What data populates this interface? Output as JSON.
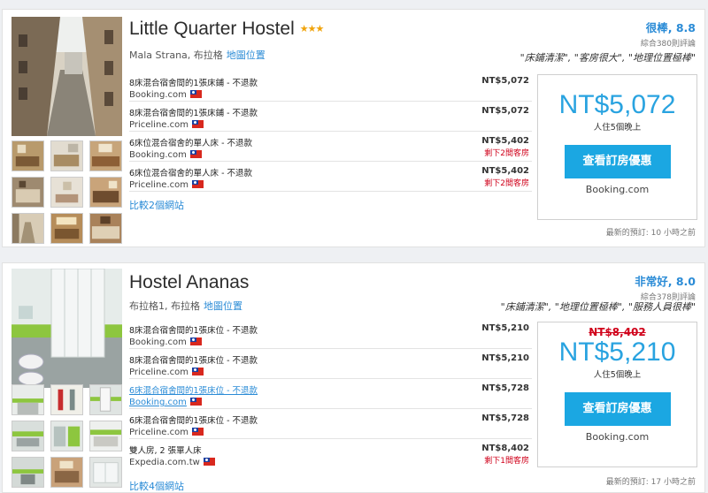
{
  "hotels": [
    {
      "name": "Little Quarter Hostel",
      "stars": "★★★",
      "location": "Mala Strana, 布拉格",
      "map_link": "地圖位置",
      "rating_score": "很棒, 8.8",
      "rating_count": "綜合380則評論",
      "quotes": "\"床鋪清潔\", \"客房很大\", \"地理位置極棒\"",
      "deals": [
        {
          "room": "8床混合宿舍間的1張床鋪 - 不退款",
          "site": "Booking.com",
          "price": "NT$5,072",
          "left": ""
        },
        {
          "room": "8床混合宿舍間的1張床鋪 - 不退款",
          "site": "Priceline.com",
          "price": "NT$5,072",
          "left": ""
        },
        {
          "room": "6床位混合宿舍的單人床 - 不退款",
          "site": "Booking.com",
          "price": "NT$5,402",
          "left": "剩下2間客房"
        },
        {
          "room": "6床位混合宿舍的單人床 - 不退款",
          "site": "Priceline.com",
          "price": "NT$5,402",
          "left": "剩下2間客房"
        }
      ],
      "compare": "比較2個網站",
      "offer": {
        "old_price": "",
        "price": "NT$5,072",
        "nights": "人住5個晚上",
        "button": "查看訂房優惠",
        "site": "Booking.com"
      },
      "recent": "最新的預訂: 10 小時之前"
    },
    {
      "name": "Hostel Ananas",
      "stars": "",
      "location": "布拉格1, 布拉格",
      "map_link": "地圖位置",
      "rating_score": "非常好, 8.0",
      "rating_count": "綜合378則評論",
      "quotes": "\"床鋪清潔\", \"地理位置極棒\", \"服務人員很棒\"",
      "deals": [
        {
          "room": "8床混合宿舍間的1張床位 - 不退款",
          "site": "Booking.com",
          "price": "NT$5,210",
          "left": ""
        },
        {
          "room": "8床混合宿舍間的1張床位 - 不退款",
          "site": "Priceline.com",
          "price": "NT$5,210",
          "left": ""
        },
        {
          "room": "6床混合宿舍間的1張床位 - 不退款",
          "site": "Booking.com",
          "price": "NT$5,728",
          "left": ""
        },
        {
          "room": "6床混合宿舍間的1張床位 - 不退款",
          "site": "Priceline.com",
          "price": "NT$5,728",
          "left": ""
        },
        {
          "room": "雙人房, 2 張單人床",
          "site": "Expedia.com.tw",
          "price": "NT$8,402",
          "left": "剩下1間客房"
        }
      ],
      "compare": "比較4個網站",
      "offer": {
        "old_price": "NT$8,402",
        "price": "NT$5,210",
        "nights": "人住5個晚上",
        "button": "查看訂房優惠",
        "site": "Booking.com"
      },
      "recent": "最新的預訂: 17 小時之前"
    }
  ],
  "colors": {
    "accent": "#29a3e0",
    "button": "#1ba7e2",
    "alert": "#d0021b",
    "stars": "#f0a30a"
  }
}
